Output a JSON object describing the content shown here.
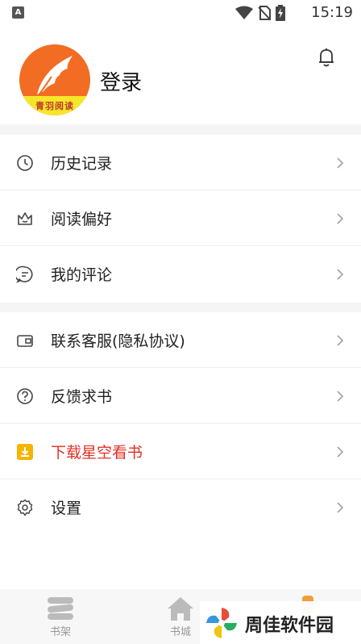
{
  "status_bar": {
    "time": "15:19",
    "notification_icon": "a-letter-icon",
    "icons": [
      "wifi-icon",
      "no-sim-icon",
      "battery-charging-icon"
    ]
  },
  "profile": {
    "login_label": "登录",
    "avatar_text": "青羽阅读",
    "bell_icon": "bell-icon"
  },
  "menu": {
    "group1": [
      {
        "label": "历史记录",
        "icon": "clock-icon"
      },
      {
        "label": "阅读偏好",
        "icon": "crown-icon"
      },
      {
        "label": "我的评论",
        "icon": "comment-icon"
      }
    ],
    "group2": [
      {
        "label": "联系客服(隐私协议)",
        "icon": "wallet-icon"
      },
      {
        "label": "反馈求书",
        "icon": "question-icon"
      },
      {
        "label": "下载星空看书",
        "icon": "download-icon"
      },
      {
        "label": "设置",
        "icon": "gear-icon"
      }
    ]
  },
  "colors": {
    "accent": "#e32f24",
    "avatar_orange": "#f36c23",
    "avatar_yellow": "#f6e62a",
    "download_icon_bg": "#f6b400",
    "tab_active": "#f39c3a"
  },
  "tabbar": {
    "tabs": [
      {
        "label": "书架",
        "icon": "bookshelf-icon"
      },
      {
        "label": "书城",
        "icon": "home-icon"
      },
      {
        "label": "",
        "icon": "profile-icon"
      }
    ]
  },
  "watermark": {
    "text": "周佳软件园"
  }
}
